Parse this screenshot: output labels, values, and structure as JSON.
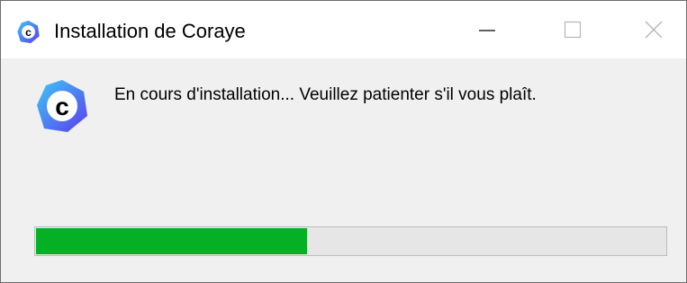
{
  "window": {
    "title": "Installation de Coraye",
    "icon": "coraye-logo-icon",
    "controls": {
      "minimize_icon": "minimize-icon",
      "maximize_icon": "maximize-icon",
      "close_icon": "close-icon"
    }
  },
  "main": {
    "app_icon": "coraye-logo-icon",
    "message": "En cours d'installation... Veuillez patienter s'il vous plaît.",
    "progress": {
      "value_percent": 43,
      "fill_color": "#06b025",
      "track_color": "#e6e6e6"
    }
  },
  "colors": {
    "logo_gradient_start": "#3ec8f5",
    "logo_gradient_end": "#5a3cf0",
    "logo_letter": "#000000"
  }
}
